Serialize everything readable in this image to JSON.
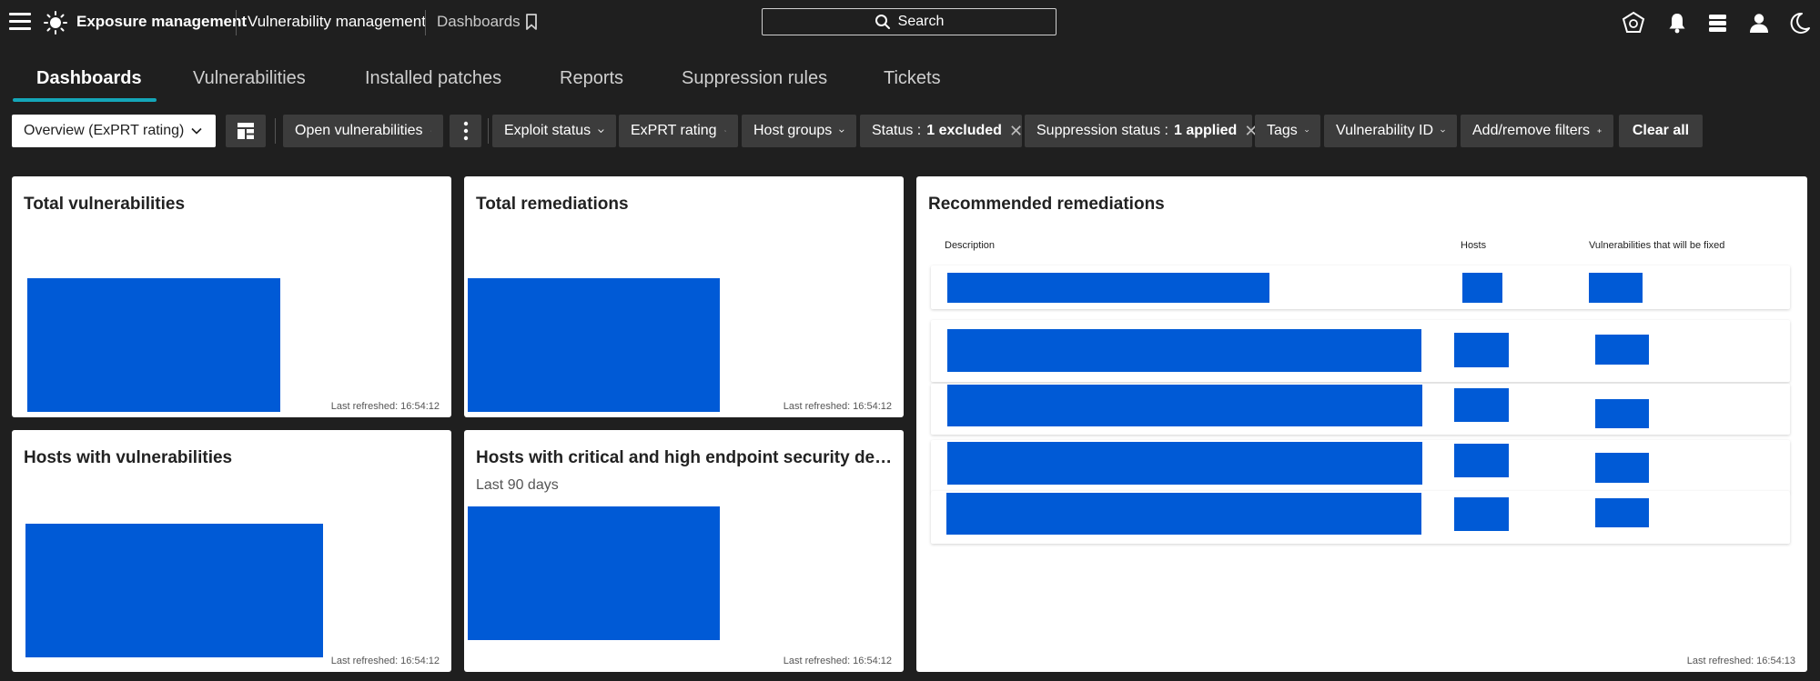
{
  "header": {
    "app_title": "Exposure management",
    "module_title": "Vulnerability management",
    "breadcrumb": "Dashboards",
    "search_label": "Search"
  },
  "tabs": [
    {
      "label": "Dashboards",
      "active": true
    },
    {
      "label": "Vulnerabilities",
      "active": false
    },
    {
      "label": "Installed patches",
      "active": false
    },
    {
      "label": "Reports",
      "active": false
    },
    {
      "label": "Suppression rules",
      "active": false
    },
    {
      "label": "Tickets",
      "active": false
    }
  ],
  "filters": {
    "dashboard_select": "Overview (ExPRT rating)",
    "open_vulnerabilities": "Open vulnerabilities",
    "exploit_status": "Exploit status",
    "exprt_rating": "ExPRT rating",
    "host_groups": "Host groups",
    "status_label": "Status :",
    "status_value": "1 excluded",
    "suppression_label": "Suppression status :",
    "suppression_value": "1 applied",
    "tags": "Tags",
    "vulnerability_id": "Vulnerability ID",
    "add_remove": "Add/remove filters",
    "clear_all": "Clear all"
  },
  "cards": {
    "total_vulnerabilities": {
      "title": "Total vulnerabilities",
      "refreshed": "Last refreshed: 16:54:12"
    },
    "total_remediations": {
      "title": "Total remediations",
      "refreshed": "Last refreshed: 16:54:12"
    },
    "hosts_with_vulnerabilities": {
      "title": "Hosts with vulnerabilities",
      "refreshed": "Last refreshed: 16:54:12"
    },
    "hosts_critical": {
      "title": "Hosts with critical and high endpoint security det...",
      "subtitle": "Last 90 days",
      "refreshed": "Last refreshed: 16:54:12"
    },
    "recommended": {
      "title": "Recommended remediations",
      "columns": [
        "Description",
        "Hosts",
        "Vulnerabilities that will be fixed"
      ],
      "refreshed": "Last refreshed: 16:54:13"
    }
  },
  "colors": {
    "accent": "#14a6b8",
    "placeholder_blue": "#005ad6",
    "background": "#1f1f1f"
  }
}
